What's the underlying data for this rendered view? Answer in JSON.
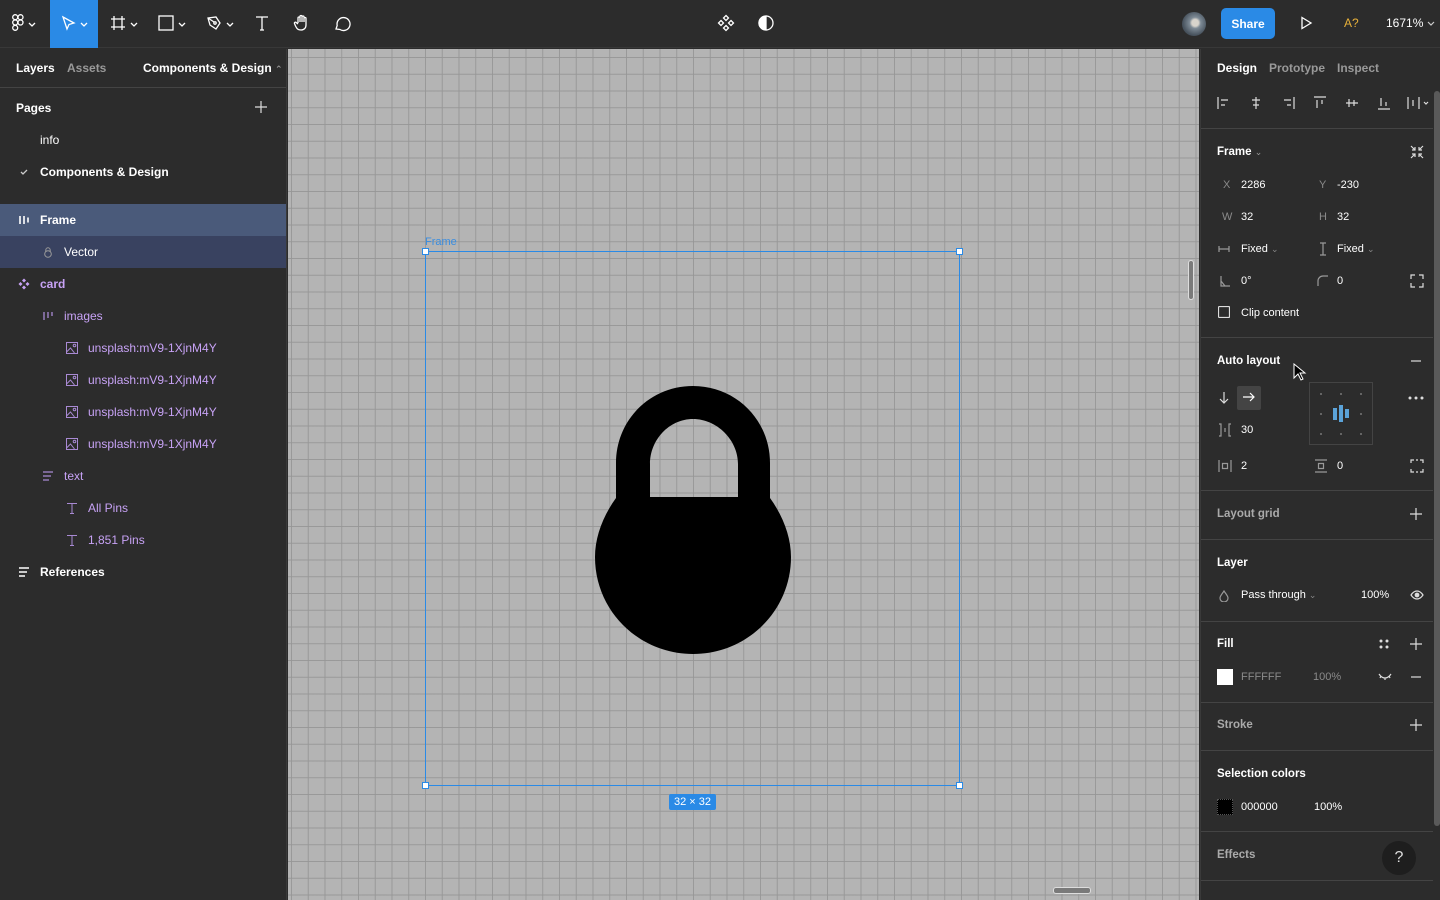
{
  "toolbar": {
    "tools": [
      {
        "name": "main-menu",
        "icon": "figma-logo-icon"
      },
      {
        "name": "move-tool",
        "icon": "cursor-arrow-icon",
        "active": true
      },
      {
        "name": "frame-tool",
        "icon": "frame-hash-icon"
      },
      {
        "name": "shape-tool",
        "icon": "rectangle-icon"
      },
      {
        "name": "pen-tool",
        "icon": "pen-icon"
      },
      {
        "name": "text-tool",
        "icon": "text-icon"
      },
      {
        "name": "hand-tool",
        "icon": "hand-icon"
      },
      {
        "name": "comment-tool",
        "icon": "comment-icon"
      }
    ],
    "center_icons": [
      "components-icon",
      "contrast-icon"
    ],
    "share_label": "Share",
    "missing_fonts": "A?",
    "zoom_level": "1671%"
  },
  "left_panel": {
    "tabs": {
      "layers": "Layers",
      "assets": "Assets",
      "page": "Components & Design"
    },
    "pages_title": "Pages",
    "pages": [
      {
        "label": "info",
        "current": false
      },
      {
        "label": "Components & Design",
        "current": true
      }
    ],
    "layers": [
      {
        "label": "Frame",
        "icon": "auto-layout-icon",
        "indent": 0,
        "state": "selected"
      },
      {
        "label": "Vector",
        "icon": "lock-vector-icon",
        "indent": 1,
        "state": "child-selected"
      },
      {
        "label": "card",
        "icon": "component-icon",
        "indent": 0,
        "state": "component"
      },
      {
        "label": "images",
        "icon": "auto-layout-icon",
        "indent": 1,
        "state": "component"
      },
      {
        "label": "unsplash:mV9-1XjnM4Y",
        "icon": "image-icon",
        "indent": 2,
        "state": "component"
      },
      {
        "label": "unsplash:mV9-1XjnM4Y",
        "icon": "image-icon",
        "indent": 2,
        "state": "component"
      },
      {
        "label": "unsplash:mV9-1XjnM4Y",
        "icon": "image-icon",
        "indent": 2,
        "state": "component"
      },
      {
        "label": "unsplash:mV9-1XjnM4Y",
        "icon": "image-icon",
        "indent": 2,
        "state": "component"
      },
      {
        "label": "text",
        "icon": "vertical-auto-layout-icon",
        "indent": 1,
        "state": "component"
      },
      {
        "label": "All Pins",
        "icon": "text-icon",
        "indent": 2,
        "state": "component"
      },
      {
        "label": "1,851 Pins",
        "icon": "text-icon",
        "indent": 2,
        "state": "component"
      },
      {
        "label": "References",
        "icon": "vertical-auto-layout-icon",
        "indent": 0,
        "state": "normal"
      }
    ]
  },
  "canvas": {
    "frame_label": "Frame",
    "size_badge": "32 × 32",
    "vector_fill": "#000000"
  },
  "right_panel": {
    "tabs": {
      "design": "Design",
      "prototype": "Prototype",
      "inspect": "Inspect"
    },
    "frame": {
      "title": "Frame",
      "x_label": "X",
      "x": "2286",
      "y_label": "Y",
      "y": "-230",
      "w_label": "W",
      "w": "32",
      "h_label": "H",
      "h": "32",
      "h_resize": "Fixed",
      "v_resize": "Fixed",
      "rotation": "0°",
      "radius": "0",
      "clip_content_label": "Clip content",
      "clip_content": false
    },
    "auto_layout": {
      "title": "Auto layout",
      "direction": "horizontal",
      "spacing": "30",
      "padding_h": "2",
      "padding_v": "0"
    },
    "layout_grid": {
      "title": "Layout grid"
    },
    "layer": {
      "title": "Layer",
      "blend": "Pass through",
      "opacity": "100%"
    },
    "fill": {
      "title": "Fill",
      "hex": "FFFFFF",
      "opacity": "100%",
      "color": "#FFFFFF"
    },
    "stroke": {
      "title": "Stroke"
    },
    "selection_colors": {
      "title": "Selection colors",
      "hex": "000000",
      "opacity": "100%",
      "color": "#000000"
    },
    "effects": {
      "title": "Effects"
    },
    "help": "?"
  }
}
